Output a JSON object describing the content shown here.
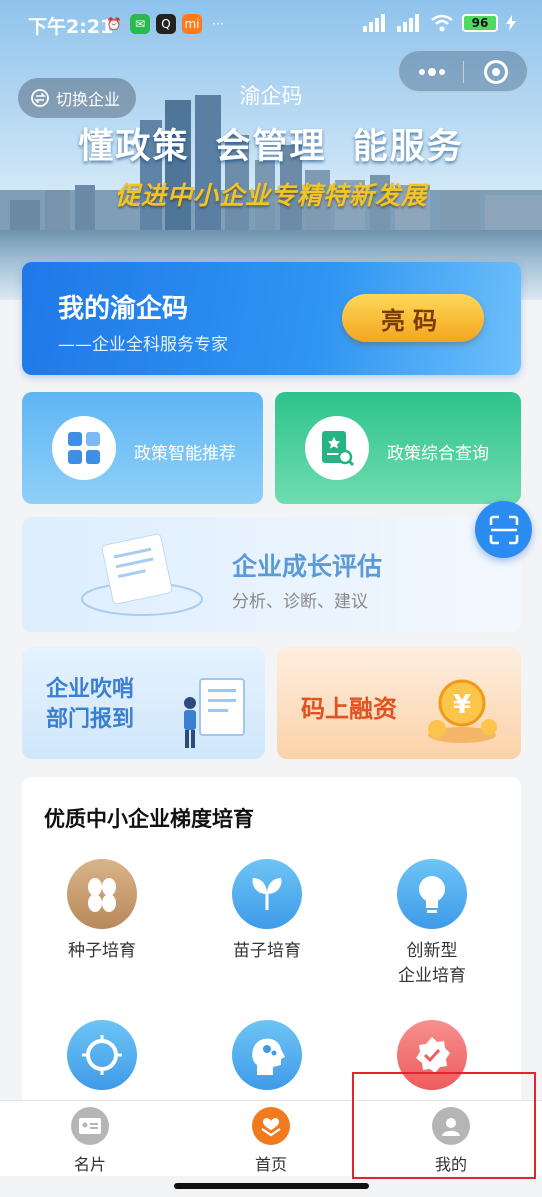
{
  "status_bar": {
    "time": "下午2:21",
    "battery": "96"
  },
  "header": {
    "switch_company": "切换企业",
    "title": "渝企码",
    "slogan": "懂政策 会管理 能服务",
    "subslogan": "促进中小企业专精特新发展"
  },
  "main_card": {
    "title": "我的渝企码",
    "subtitle": "——企业全科服务专家",
    "button": "亮码"
  },
  "tiles": {
    "policy_recommend": "政策智能推荐",
    "policy_query": "政策综合查询",
    "growth_title": "企业成长评估",
    "growth_sub": "分析、诊断、建议",
    "whistle_line1": "企业吹哨",
    "whistle_line2": "部门报到",
    "finance": "码上融资"
  },
  "cultivation": {
    "title": "优质中小企业梯度培育",
    "items": [
      {
        "label": "种子培育"
      },
      {
        "label": "苗子培育"
      },
      {
        "label_line1": "创新型",
        "label_line2": "企业培育"
      }
    ]
  },
  "tabbar": {
    "items": [
      {
        "label": "名片"
      },
      {
        "label": "首页"
      },
      {
        "label": "我的"
      }
    ]
  },
  "colors": {
    "primary_blue": "#2a8cf0",
    "green": "#2ec38c",
    "orange": "#f4a51e",
    "highlight_red": "#e0262b"
  }
}
